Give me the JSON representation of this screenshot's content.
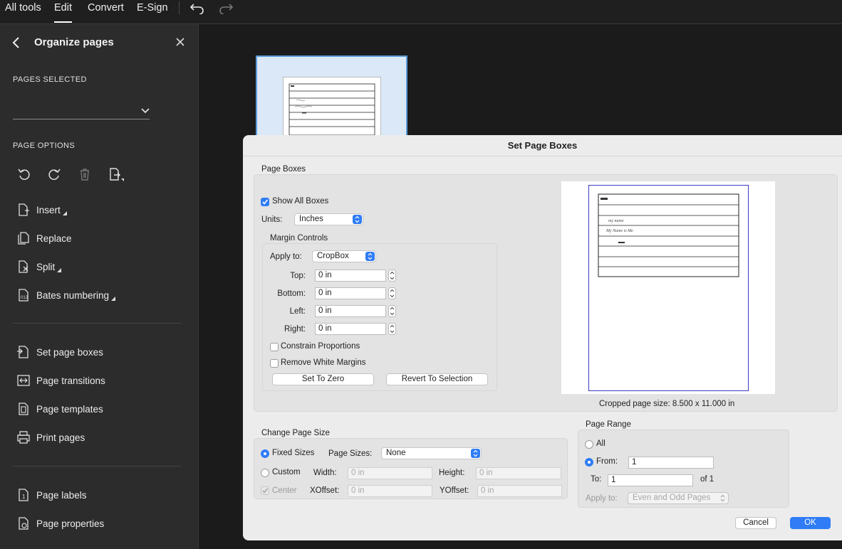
{
  "topbar": {
    "menus": [
      "All tools",
      "Edit",
      "Convert",
      "E-Sign"
    ],
    "active_menu": "Edit"
  },
  "left_panel": {
    "title": "Organize pages",
    "pages_selected_label": "PAGES SELECTED",
    "pages_selected_value": "",
    "page_options_label": "PAGE OPTIONS",
    "option_icons": [
      "rotate-left-icon",
      "rotate-right-icon",
      "delete-icon",
      "extract-pages-icon"
    ],
    "items_group1": [
      "Insert",
      "Replace",
      "Split",
      "Bates numbering"
    ],
    "items_group2": [
      "Set page boxes",
      "Page transitions",
      "Page templates",
      "Print pages"
    ],
    "items_group3": [
      "Page labels",
      "Page properties"
    ]
  },
  "dialog": {
    "title": "Set Page Boxes",
    "page_boxes": {
      "label": "Page Boxes",
      "show_all_boxes_label": "Show All Boxes",
      "show_all_boxes_checked": true,
      "units_label": "Units:",
      "units_value": "Inches",
      "margin_controls": {
        "label": "Margin Controls",
        "apply_to_label": "Apply to:",
        "apply_to_value": "CropBox",
        "top_label": "Top:",
        "top_value": "0 in",
        "bottom_label": "Bottom:",
        "bottom_value": "0 in",
        "left_label": "Left:",
        "left_value": "0 in",
        "right_label": "Right:",
        "right_value": "0 in",
        "constrain_label": "Constrain Proportions",
        "remove_white_label": "Remove White Margins",
        "set_zero_label": "Set To Zero",
        "revert_label": "Revert To Selection"
      },
      "cropped_size": "Cropped page size: 8.500 x 11.000 in"
    },
    "change_page_size": {
      "label": "Change Page Size",
      "fixed_sizes_label": "Fixed Sizes",
      "page_sizes_label": "Page Sizes:",
      "page_sizes_value": "None",
      "custom_label": "Custom",
      "width_label": "Width:",
      "width_value": "0 in",
      "height_label": "Height:",
      "height_value": "0 in",
      "center_label": "Center",
      "xoffset_label": "XOffset:",
      "xoffset_value": "0 in",
      "yoffset_label": "YOffset:",
      "yoffset_value": "0 in"
    },
    "page_range": {
      "label": "Page Range",
      "all_label": "All",
      "from_label": "From:",
      "from_value": "1",
      "to_label": "To:",
      "to_value": "1",
      "of_label": "of 1",
      "apply_to_label": "Apply to:",
      "apply_to_value": "Even and Odd Pages"
    },
    "cancel_label": "Cancel",
    "ok_label": "OK"
  },
  "preview_handwriting": [
    "my name",
    "My Name is Me"
  ],
  "colors": {
    "accent": "#2f7cf6",
    "panel": "#2c2c2c",
    "dialog": "#ececec"
  }
}
